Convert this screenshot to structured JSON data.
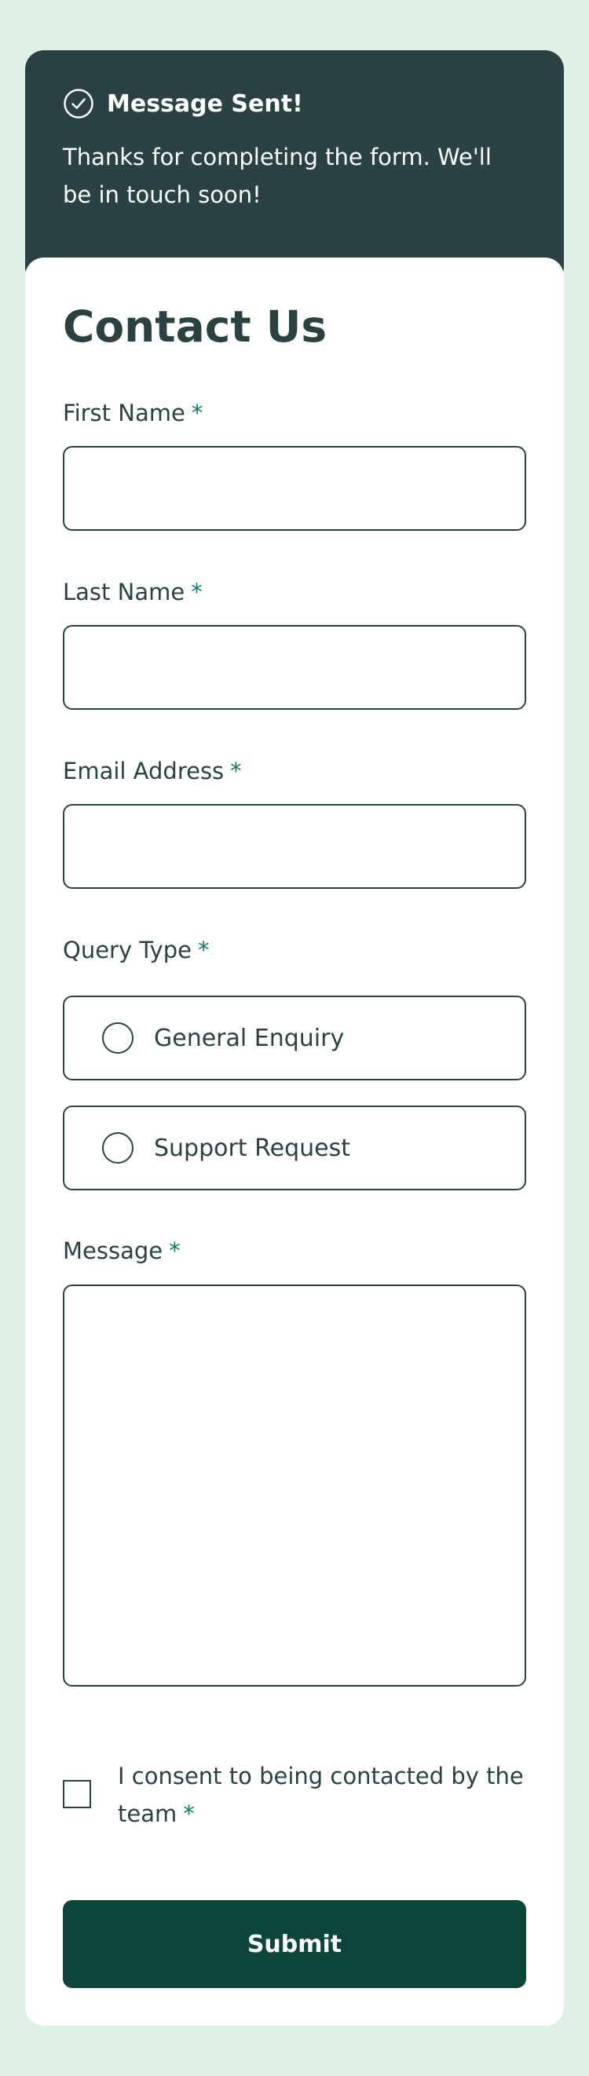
{
  "toast": {
    "icon": "check-circle-icon",
    "title": "Message Sent!",
    "text": "Thanks for completing the form. We'll be in touch soon!"
  },
  "form": {
    "title": "Contact Us",
    "required_mark": "*",
    "first_name": {
      "label": "First Name",
      "value": ""
    },
    "last_name": {
      "label": "Last Name",
      "value": ""
    },
    "email": {
      "label": "Email Address",
      "value": ""
    },
    "query_type": {
      "label": "Query Type",
      "options": [
        "General Enquiry",
        "Support Request"
      ]
    },
    "message": {
      "label": "Message",
      "value": ""
    },
    "consent": {
      "label": "I consent to being contacted by the team"
    },
    "submit_label": "Submit"
  },
  "colors": {
    "page_background": "#dff1e7",
    "toast_background": "#2a4244",
    "accent": "#0c7d69",
    "button": "#0c4539",
    "text": "#2a4244"
  }
}
